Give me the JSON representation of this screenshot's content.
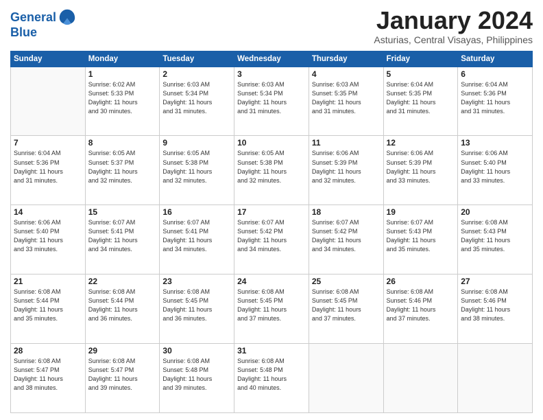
{
  "logo": {
    "line1": "General",
    "line2": "Blue"
  },
  "title": "January 2024",
  "subtitle": "Asturias, Central Visayas, Philippines",
  "days_header": [
    "Sunday",
    "Monday",
    "Tuesday",
    "Wednesday",
    "Thursday",
    "Friday",
    "Saturday"
  ],
  "weeks": [
    [
      {
        "num": "",
        "info": ""
      },
      {
        "num": "1",
        "info": "Sunrise: 6:02 AM\nSunset: 5:33 PM\nDaylight: 11 hours\nand 30 minutes."
      },
      {
        "num": "2",
        "info": "Sunrise: 6:03 AM\nSunset: 5:34 PM\nDaylight: 11 hours\nand 31 minutes."
      },
      {
        "num": "3",
        "info": "Sunrise: 6:03 AM\nSunset: 5:34 PM\nDaylight: 11 hours\nand 31 minutes."
      },
      {
        "num": "4",
        "info": "Sunrise: 6:03 AM\nSunset: 5:35 PM\nDaylight: 11 hours\nand 31 minutes."
      },
      {
        "num": "5",
        "info": "Sunrise: 6:04 AM\nSunset: 5:35 PM\nDaylight: 11 hours\nand 31 minutes."
      },
      {
        "num": "6",
        "info": "Sunrise: 6:04 AM\nSunset: 5:36 PM\nDaylight: 11 hours\nand 31 minutes."
      }
    ],
    [
      {
        "num": "7",
        "info": "Sunrise: 6:04 AM\nSunset: 5:36 PM\nDaylight: 11 hours\nand 31 minutes."
      },
      {
        "num": "8",
        "info": "Sunrise: 6:05 AM\nSunset: 5:37 PM\nDaylight: 11 hours\nand 32 minutes."
      },
      {
        "num": "9",
        "info": "Sunrise: 6:05 AM\nSunset: 5:38 PM\nDaylight: 11 hours\nand 32 minutes."
      },
      {
        "num": "10",
        "info": "Sunrise: 6:05 AM\nSunset: 5:38 PM\nDaylight: 11 hours\nand 32 minutes."
      },
      {
        "num": "11",
        "info": "Sunrise: 6:06 AM\nSunset: 5:39 PM\nDaylight: 11 hours\nand 32 minutes."
      },
      {
        "num": "12",
        "info": "Sunrise: 6:06 AM\nSunset: 5:39 PM\nDaylight: 11 hours\nand 33 minutes."
      },
      {
        "num": "13",
        "info": "Sunrise: 6:06 AM\nSunset: 5:40 PM\nDaylight: 11 hours\nand 33 minutes."
      }
    ],
    [
      {
        "num": "14",
        "info": "Sunrise: 6:06 AM\nSunset: 5:40 PM\nDaylight: 11 hours\nand 33 minutes."
      },
      {
        "num": "15",
        "info": "Sunrise: 6:07 AM\nSunset: 5:41 PM\nDaylight: 11 hours\nand 34 minutes."
      },
      {
        "num": "16",
        "info": "Sunrise: 6:07 AM\nSunset: 5:41 PM\nDaylight: 11 hours\nand 34 minutes."
      },
      {
        "num": "17",
        "info": "Sunrise: 6:07 AM\nSunset: 5:42 PM\nDaylight: 11 hours\nand 34 minutes."
      },
      {
        "num": "18",
        "info": "Sunrise: 6:07 AM\nSunset: 5:42 PM\nDaylight: 11 hours\nand 34 minutes."
      },
      {
        "num": "19",
        "info": "Sunrise: 6:07 AM\nSunset: 5:43 PM\nDaylight: 11 hours\nand 35 minutes."
      },
      {
        "num": "20",
        "info": "Sunrise: 6:08 AM\nSunset: 5:43 PM\nDaylight: 11 hours\nand 35 minutes."
      }
    ],
    [
      {
        "num": "21",
        "info": "Sunrise: 6:08 AM\nSunset: 5:44 PM\nDaylight: 11 hours\nand 35 minutes."
      },
      {
        "num": "22",
        "info": "Sunrise: 6:08 AM\nSunset: 5:44 PM\nDaylight: 11 hours\nand 36 minutes."
      },
      {
        "num": "23",
        "info": "Sunrise: 6:08 AM\nSunset: 5:45 PM\nDaylight: 11 hours\nand 36 minutes."
      },
      {
        "num": "24",
        "info": "Sunrise: 6:08 AM\nSunset: 5:45 PM\nDaylight: 11 hours\nand 37 minutes."
      },
      {
        "num": "25",
        "info": "Sunrise: 6:08 AM\nSunset: 5:45 PM\nDaylight: 11 hours\nand 37 minutes."
      },
      {
        "num": "26",
        "info": "Sunrise: 6:08 AM\nSunset: 5:46 PM\nDaylight: 11 hours\nand 37 minutes."
      },
      {
        "num": "27",
        "info": "Sunrise: 6:08 AM\nSunset: 5:46 PM\nDaylight: 11 hours\nand 38 minutes."
      }
    ],
    [
      {
        "num": "28",
        "info": "Sunrise: 6:08 AM\nSunset: 5:47 PM\nDaylight: 11 hours\nand 38 minutes."
      },
      {
        "num": "29",
        "info": "Sunrise: 6:08 AM\nSunset: 5:47 PM\nDaylight: 11 hours\nand 39 minutes."
      },
      {
        "num": "30",
        "info": "Sunrise: 6:08 AM\nSunset: 5:48 PM\nDaylight: 11 hours\nand 39 minutes."
      },
      {
        "num": "31",
        "info": "Sunrise: 6:08 AM\nSunset: 5:48 PM\nDaylight: 11 hours\nand 40 minutes."
      },
      {
        "num": "",
        "info": ""
      },
      {
        "num": "",
        "info": ""
      },
      {
        "num": "",
        "info": ""
      }
    ]
  ]
}
